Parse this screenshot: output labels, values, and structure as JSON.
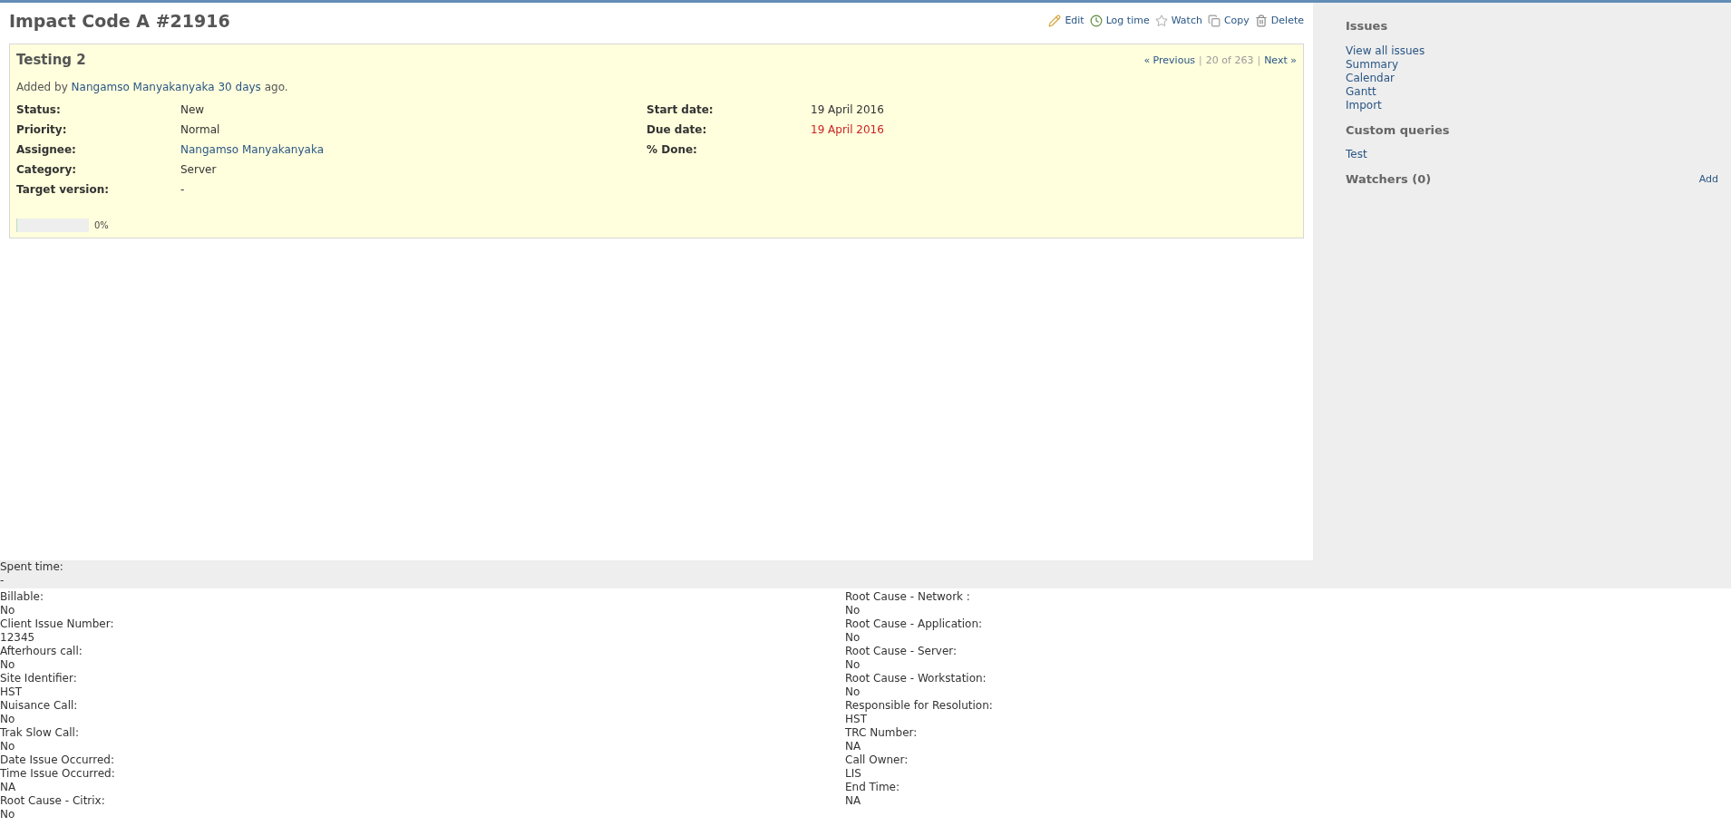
{
  "title": "Impact Code A #21916",
  "actions": [
    {
      "kind": "edit",
      "label": "Edit"
    },
    {
      "kind": "log",
      "label": "Log time"
    },
    {
      "kind": "watch",
      "label": "Watch"
    },
    {
      "kind": "copy",
      "label": "Copy"
    },
    {
      "kind": "delete",
      "label": "Delete"
    }
  ],
  "issue": {
    "subject": "Testing 2",
    "pager": {
      "previous": "« Previous",
      "separator": "|",
      "position": "20 of 263",
      "next": "Next »"
    },
    "author_line": {
      "prefix": "Added by",
      "author": "Nangamso Manyakanyaka",
      "age": "30 days",
      "suffix": "ago."
    },
    "attributes_left": [
      {
        "label": "Status:",
        "value": "New",
        "kind": "text"
      },
      {
        "label": "Priority:",
        "value": "Normal",
        "kind": "text"
      },
      {
        "label": "Assignee:",
        "value": "Nangamso Manyakanyaka",
        "kind": "link"
      },
      {
        "label": "Category:",
        "value": "Server",
        "kind": "text"
      },
      {
        "label": "Target version:",
        "value": "-",
        "kind": "text"
      }
    ],
    "attributes_right": [
      {
        "label": "Start date:",
        "value": "19 April 2016",
        "kind": "text"
      },
      {
        "label": "Due date:",
        "value": "19 April 2016",
        "kind": "overdue"
      },
      {
        "label": "% Done:"
      }
    ],
    "progress": {
      "level": 0,
      "reading": "0%"
    }
  },
  "sidebar": {
    "sections": [
      {
        "heading": "Issues",
        "links": [
          "View all issues",
          "Summary",
          "Calendar",
          "Gantt",
          "Import"
        ]
      },
      {
        "heading": "Custom queries",
        "links": [
          "Test"
        ]
      },
      {
        "heading": "Watchers (0)",
        "action": "Add"
      }
    ]
  },
  "spent_time": {
    "label": "Spent time:",
    "value": "-"
  },
  "custom_fields_left": [
    {
      "label": "Billable:",
      "value": "No"
    },
    {
      "label": "Client Issue Number:",
      "value": "12345"
    },
    {
      "label": "Afterhours call:",
      "value": "No"
    },
    {
      "label": "Site Identifier:",
      "value": "HST"
    },
    {
      "label": "Nuisance Call:",
      "value": "No"
    },
    {
      "label": "Trak Slow Call:",
      "value": "No"
    },
    {
      "label": "Date Issue Occurred:"
    },
    {
      "label": "Time Issue Occurred:",
      "value": "NA"
    },
    {
      "label": "Root Cause - Citrix:",
      "value": "No"
    }
  ],
  "custom_fields_right": [
    {
      "label": "Root Cause - Network :",
      "value": "No"
    },
    {
      "label": "Root Cause - Application:",
      "value": "No"
    },
    {
      "label": "Root Cause - Server:",
      "value": "No"
    },
    {
      "label": "Root Cause - Workstation:",
      "value": "No"
    },
    {
      "label": "Responsible for Resolution:",
      "value": "HST"
    },
    {
      "label": "TRC Number:",
      "value": "NA"
    },
    {
      "label": "Call Owner:",
      "value": "LIS"
    },
    {
      "label": "End Time:",
      "value": "NA"
    }
  ]
}
